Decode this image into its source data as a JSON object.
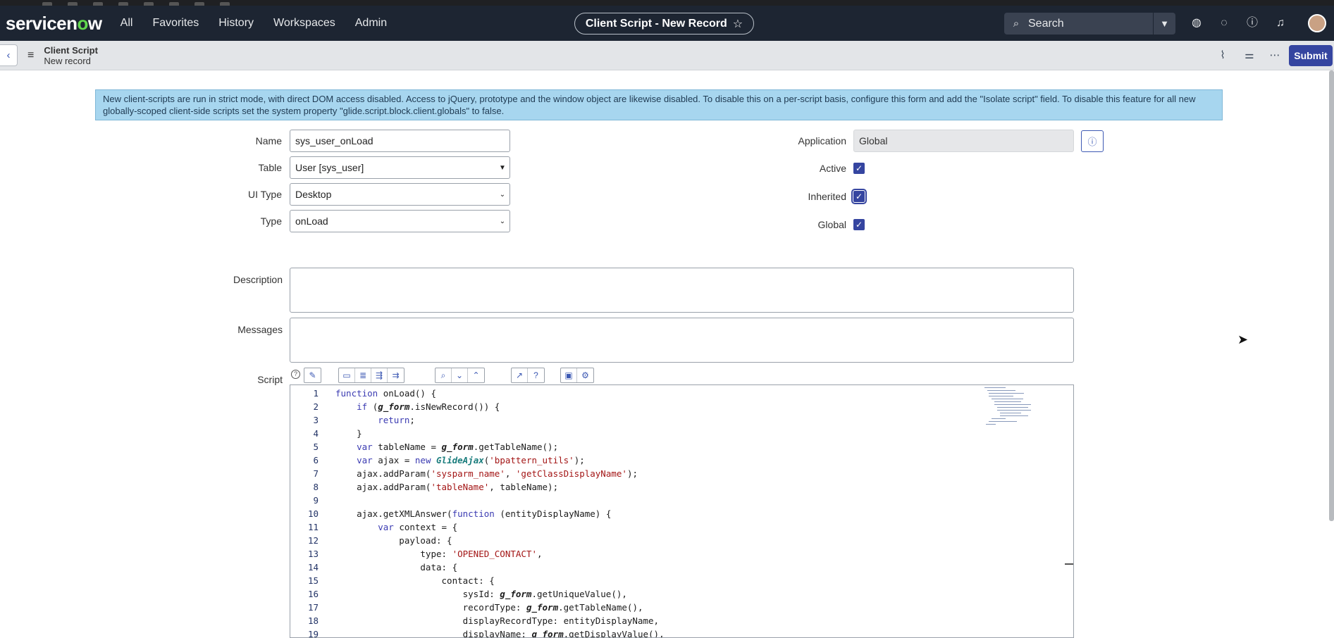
{
  "nav": {
    "logo": "servicenow",
    "items": [
      "All",
      "Favorites",
      "History",
      "Workspaces",
      "Admin"
    ],
    "context_title": "Client Script - New Record",
    "search_placeholder": "Search"
  },
  "header": {
    "title": "Client Script",
    "subtitle": "New record",
    "submit_label": "Submit"
  },
  "banner": {
    "text": "New client-scripts are run in strict mode, with direct DOM access disabled. Access to jQuery, prototype and the window object are likewise disabled. To disable this on a per-script basis, configure this form and add the \"Isolate script\" field. To disable this feature for all new globally-scoped client-side scripts set the system property \"glide.script.block.client.globals\" to false."
  },
  "form": {
    "name_label": "Name",
    "name_value": "sys_user_onLoad",
    "table_label": "Table",
    "table_value": "User [sys_user]",
    "uitype_label": "UI Type",
    "uitype_value": "Desktop",
    "type_label": "Type",
    "type_value": "onLoad",
    "application_label": "Application",
    "application_value": "Global",
    "active_label": "Active",
    "inherited_label": "Inherited",
    "global_label": "Global",
    "description_label": "Description",
    "messages_label": "Messages",
    "script_label": "Script"
  },
  "checkboxes": {
    "active": true,
    "inherited": true,
    "global": true
  },
  "code": [
    {
      "n": "1",
      "t": "function onLoad() {"
    },
    {
      "n": "2",
      "t": "    if (g_form.isNewRecord()) {"
    },
    {
      "n": "3",
      "t": "        return;"
    },
    {
      "n": "4",
      "t": "    }"
    },
    {
      "n": "5",
      "t": "    var tableName = g_form.getTableName();"
    },
    {
      "n": "6",
      "t": "    var ajax = new GlideAjax('bpattern_utils');"
    },
    {
      "n": "7",
      "t": "    ajax.addParam('sysparm_name', 'getClassDisplayName');"
    },
    {
      "n": "8",
      "t": "    ajax.addParam('tableName', tableName);"
    },
    {
      "n": "9",
      "t": ""
    },
    {
      "n": "10",
      "t": "    ajax.getXMLAnswer(function (entityDisplayName) {"
    },
    {
      "n": "11",
      "t": "        var context = {"
    },
    {
      "n": "12",
      "t": "            payload: {"
    },
    {
      "n": "13",
      "t": "                type: 'OPENED_CONTACT',"
    },
    {
      "n": "14",
      "t": "                data: {"
    },
    {
      "n": "15",
      "t": "                    contact: {"
    },
    {
      "n": "16",
      "t": "                        sysId: g_form.getUniqueValue(),"
    },
    {
      "n": "17",
      "t": "                        recordType: g_form.getTableName(),"
    },
    {
      "n": "18",
      "t": "                        displayRecordType: entityDisplayName,"
    },
    {
      "n": "19",
      "t": "                        displayName: g_form.getDisplayValue(),"
    }
  ]
}
